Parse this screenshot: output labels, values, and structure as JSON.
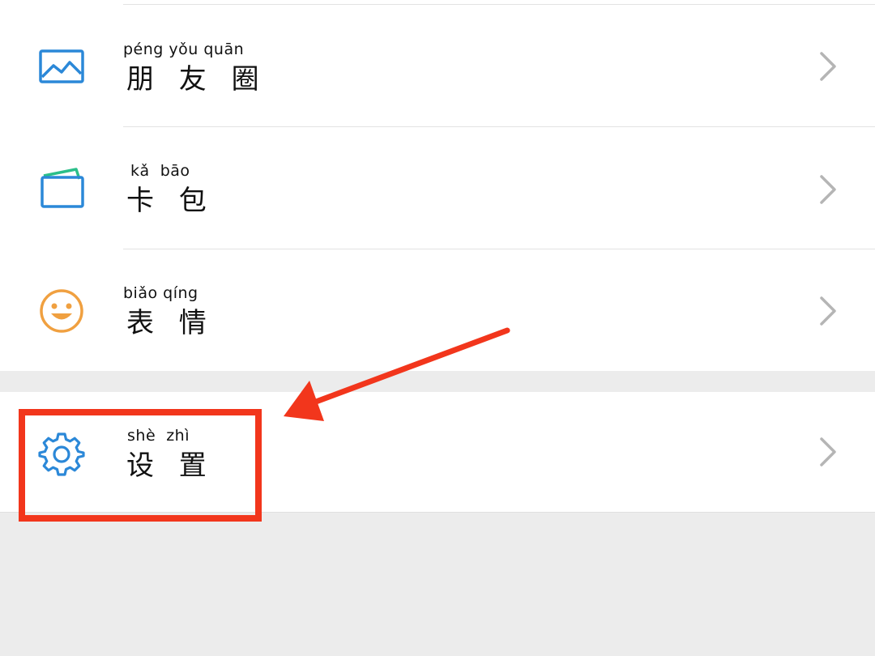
{
  "menu": {
    "items": [
      {
        "pinyin": "péng yǒu quān",
        "label": "朋 友 圈",
        "icon": "photo-album-icon"
      },
      {
        "pinyin": "kǎ  bāo",
        "label": "卡 包",
        "icon": "wallet-icon"
      },
      {
        "pinyin": "biǎo qíng",
        "label": "表 情",
        "icon": "smiley-icon"
      }
    ],
    "settings": {
      "pinyin": "shè  zhì",
      "label": "设 置",
      "icon": "gear-icon"
    }
  },
  "colors": {
    "icon_blue": "#2b88d8",
    "icon_green": "#2bbf8a",
    "icon_orange": "#f0a040",
    "annotation_red": "#f2361c",
    "chevron_gray": "#b5b5b5",
    "background": "#ececec"
  }
}
